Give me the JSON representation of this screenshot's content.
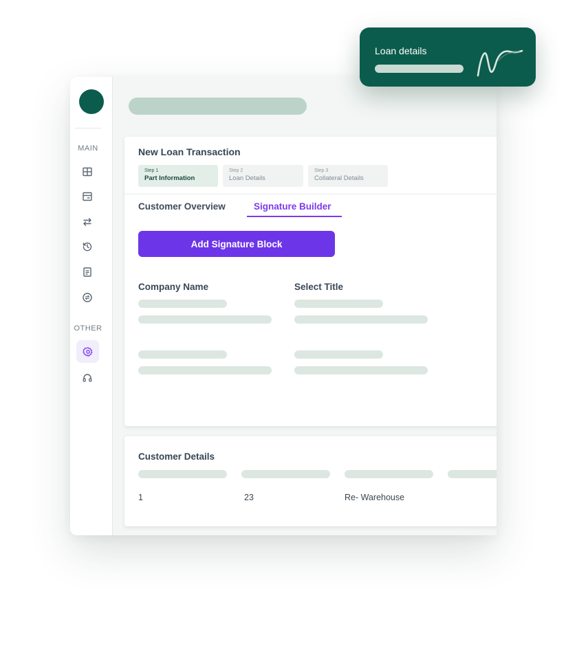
{
  "sidebar": {
    "sections": {
      "main": "MAIN",
      "other": "OTHER"
    },
    "items": [
      {
        "icon": "grid-icon"
      },
      {
        "icon": "card-icon"
      },
      {
        "icon": "transfer-arrows-icon"
      },
      {
        "icon": "history-icon"
      },
      {
        "icon": "document-icon"
      },
      {
        "icon": "exchange-circle-icon"
      },
      {
        "icon": "gear-icon",
        "active": true
      },
      {
        "icon": "headset-icon"
      }
    ]
  },
  "transaction": {
    "title": "New Loan Transaction",
    "steps": [
      {
        "number": "Step 1",
        "label": "Part Information",
        "active": true
      },
      {
        "number": "Step 2",
        "label": "Loan Details"
      },
      {
        "number": "Step 3",
        "label": "Collateral Details"
      }
    ],
    "tabs": [
      {
        "label": "Customer Overview"
      },
      {
        "label": "Signature Builder",
        "active": true
      }
    ],
    "add_button": "Add Signature Block",
    "columns": {
      "company": "Company Name",
      "title": "Select Title"
    }
  },
  "customer_details": {
    "title": "Customer Details",
    "row": [
      "1",
      "23",
      "Re- Warehouse"
    ]
  },
  "toast": {
    "title": "Loan details"
  },
  "colors": {
    "brand": "#0c5c4e",
    "accent": "#6d35e8",
    "skeleton": "#dde7e2"
  }
}
